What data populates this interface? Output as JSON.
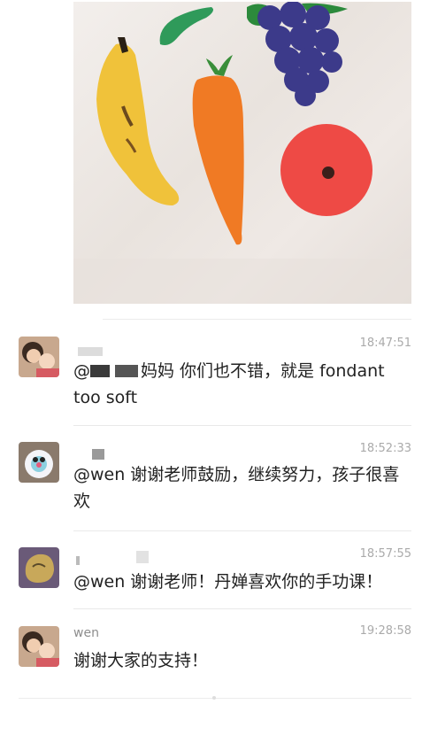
{
  "photo": {
    "icon": "fruit-photo"
  },
  "comments": [
    {
      "name": "",
      "time": "18:47:51",
      "text": "@　　　妈妈 你们也不错，就是 fondant too soft"
    },
    {
      "name": "",
      "time": "18:52:33",
      "text": "@wen 谢谢老师鼓励，继续努力，孩子很喜欢"
    },
    {
      "name": "",
      "time": "18:57:55",
      "text": "@wen 谢谢老师！丹婵喜欢你的手功课！"
    },
    {
      "name": "wen",
      "time": "19:28:58",
      "text": "谢谢大家的支持！"
    }
  ]
}
